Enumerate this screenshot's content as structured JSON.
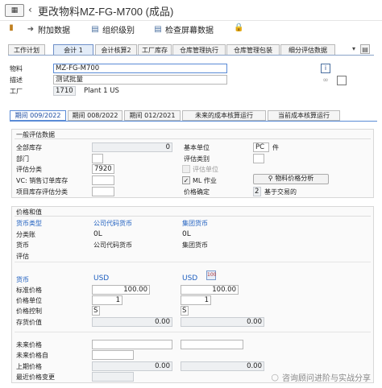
{
  "window": {
    "icon_label": "▦",
    "title": "更改物料MZ-FG-M700 (成品)"
  },
  "toolbar": {
    "additional_data": "附加数据",
    "org_levels": "组织级别",
    "check_screen_data": "检查屏幕数据"
  },
  "view_tabs": [
    "工作计划",
    "会计 1",
    "会计核算2",
    "工厂库存",
    "仓库管理执行",
    "仓库管理包装",
    "细分评估数据"
  ],
  "header": {
    "material_label": "物料",
    "material_value": "MZ-FG-M700",
    "desc_label": "描述",
    "desc_value": "测试批量",
    "plant_label": "工厂",
    "plant_value": "1710",
    "plant_name": "Plant 1 US"
  },
  "period_tabs": [
    "期间 009/2022",
    "期间 008/2022",
    "期间 012/2021",
    "未来的成本核算运行",
    "当前成本核算运行"
  ],
  "general": {
    "title": "一般评估数据",
    "total_stock_label": "全部库存",
    "total_stock_value": "0",
    "base_unit_label": "基本单位",
    "base_unit_value": "PC",
    "base_unit_text": "件",
    "division_label": "部门",
    "valuation_type_label": "评估类别",
    "valuation_class_label": "评估分类",
    "valuation_class_value": "7920",
    "valuation_unit_label": "评估单位",
    "vc_label": "VC: 销售订单库存",
    "ml_label": "ML 作业",
    "price_analysis_button": "物料价格分析",
    "proj_stock_label": "项目库存评估分类",
    "price_determ_label": "价格确定",
    "price_determ_value": "2",
    "price_determ_text": "基于交易的"
  },
  "prices": {
    "title": "价格和值",
    "currency_type_label": "货币类型",
    "currency_type_company": "公司代码货币",
    "currency_type_group": "集团货币",
    "ledger_label": "分类账",
    "ledger_company": "0L",
    "ledger_group": "0L",
    "currency_label": "货币",
    "currency_company": "公司代码货币",
    "currency_group": "集团货币",
    "valuation_label": "评估",
    "currency2_label": "货币",
    "currency2_company": "USD",
    "currency2_group": "USD",
    "std_price_label": "标准价格",
    "std_price_company": "100.00",
    "std_price_group": "100.00",
    "price_unit_label": "价格单位",
    "price_unit_company": "1",
    "price_unit_group": "1",
    "price_control_label": "价格控制",
    "price_control_company": "S",
    "price_control_group": "S",
    "inventory_value_label": "存货价值",
    "inventory_value_company": "0.00",
    "inventory_value_group": "0.00",
    "future_price_label": "未来价格",
    "future_price_from_label": "未来价格自",
    "prev_price_label": "上期价格",
    "prev_price_company": "0.00",
    "prev_price_group": "0.00",
    "last_price_change_label": "最近价格变更"
  },
  "watermark": "咨询顾问进阶与实战分享"
}
